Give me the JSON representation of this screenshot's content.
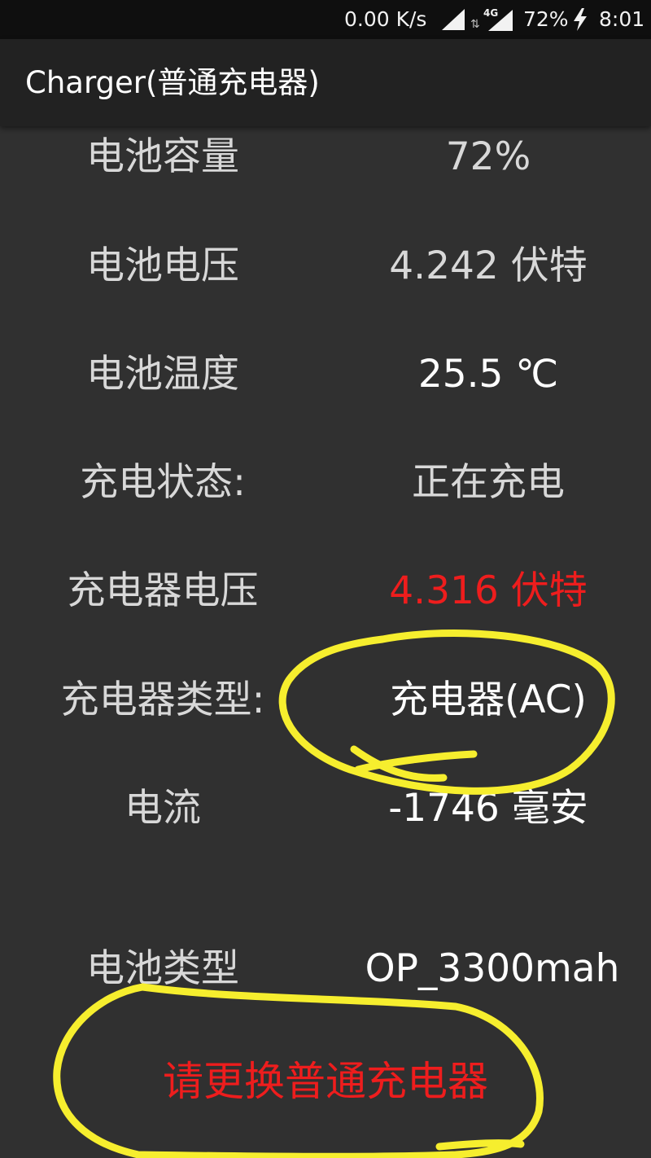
{
  "status_bar": {
    "net_speed": "0.00 K/s",
    "network_type": "4G",
    "battery": "72%",
    "time": "8:01"
  },
  "app": {
    "title": "Charger(普通充电器)"
  },
  "rows": [
    {
      "label": "电池容量",
      "value": "72%"
    },
    {
      "label": "电池电压",
      "value": "4.242 伏特"
    },
    {
      "label": "电池温度",
      "value": "25.5 ℃"
    },
    {
      "label": "充电状态:",
      "value": "正在充电"
    },
    {
      "label": "充电器电压",
      "value": "4.316 伏特"
    },
    {
      "label": "充电器类型:",
      "value": "充电器(AC)"
    },
    {
      "label": "电流",
      "value": "-1746 毫安"
    },
    {
      "label": "电池类型",
      "value": "OP_3300mah"
    }
  ],
  "warning": "请更换普通充电器",
  "colors": {
    "background": "#303030",
    "app_bar": "#222222",
    "status_bar": "#0f0f0f",
    "alert_red": "#ee1d1d",
    "highlight_yellow": "#f6ee2e"
  }
}
